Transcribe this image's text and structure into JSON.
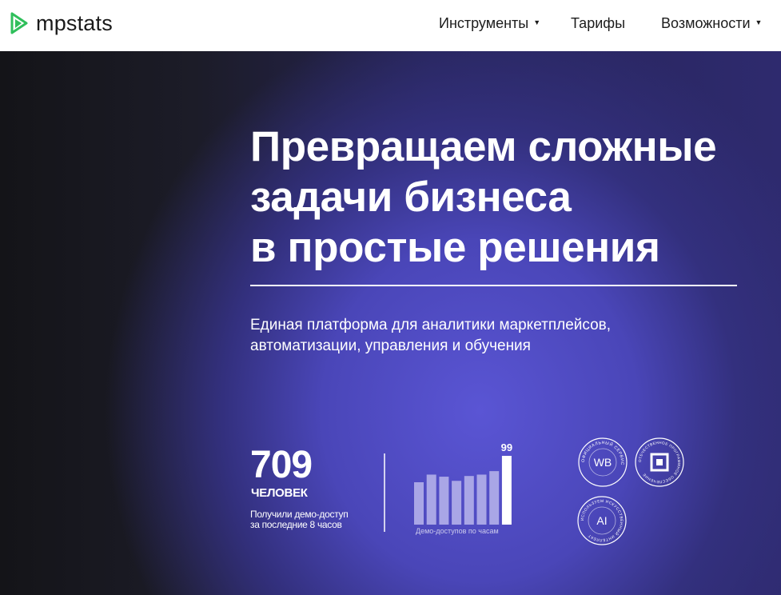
{
  "header": {
    "logo_text": "mpstats",
    "nav": {
      "tools": "Инструменты",
      "prices": "Тарифы",
      "features": "Возможности"
    }
  },
  "hero": {
    "title_lines": [
      "Превращаем сложные",
      "задачи бизнеса",
      "в простые решения"
    ],
    "subtitle_lines": [
      "Единая платформа для аналитики маркетплейсов,",
      "автоматизации, управления и обучения"
    ]
  },
  "stats": {
    "number": "709",
    "unit": "ЧЕЛОВЕК",
    "desc_lines": [
      "Получили демо-доступ",
      "за последние 8 часов"
    ]
  },
  "chart_data": {
    "type": "bar",
    "values": [
      61,
      72,
      69,
      63,
      70,
      72,
      77,
      99
    ],
    "data_label": "99",
    "xlabel": "Демо-доступов по часам"
  },
  "badges": {
    "wb": {
      "label": "WB",
      "ring_text": "ОФИЦИАЛЬНЫЙ СЕРВИС"
    },
    "soft": {
      "ring_text": "ОТЕЧЕСТВЕННОЕ ПРОГРАММНОЕ ОБЕСПЕЧЕНИЕ"
    },
    "ai": {
      "label": "AI",
      "ring_text": "ИСПОЛЬЗУЕМ ИСКУССТВЕННЫЙ ИНТЕЛЛЕКТ"
    }
  },
  "colors": {
    "brand_green": "#2fbf5b",
    "bar_light": "#a9a6e6",
    "bar_highlight": "#ffffff"
  }
}
